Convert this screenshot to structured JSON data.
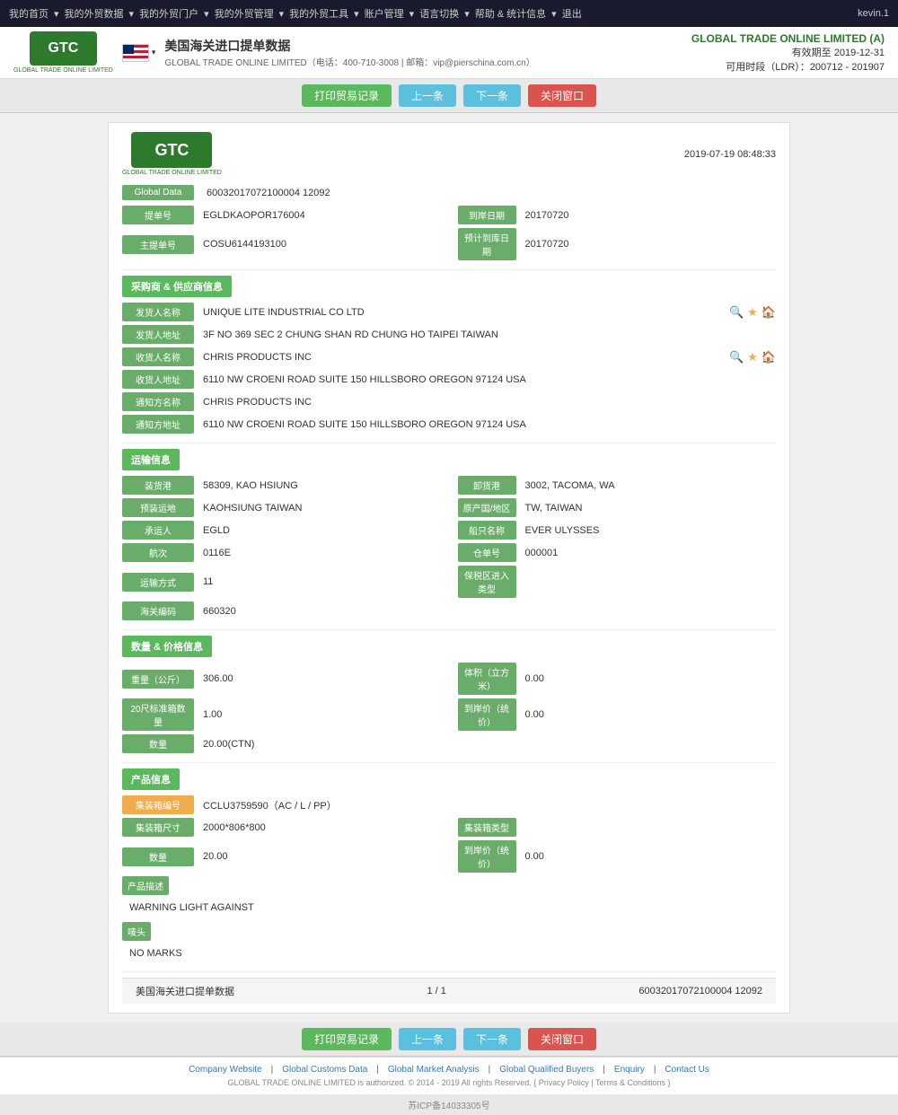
{
  "topnav": {
    "items": [
      "我的首页",
      "我的外贸数据",
      "我的外贸门户",
      "我的外贸管理",
      "我的外贸工具",
      "账户管理",
      "语言切换",
      "帮助 & 统计信息",
      "退出"
    ],
    "user": "kevin.1"
  },
  "header": {
    "logo": "GTC",
    "logo_sub": "GLOBAL TRADE ONLINE LIMITED",
    "flag_alt": "US Flag",
    "title": "美国海关进口提单数据",
    "subtitle_company": "GLOBAL TRADE ONLINE LIMITED",
    "subtitle_phone": "电话：400-710-3008",
    "subtitle_email": "邮箱：vip@pierschina.com.cn",
    "brand": "GLOBAL TRADE ONLINE LIMITED (A)",
    "validity_label": "有效期至",
    "validity_date": "2019-12-31",
    "ldr_label": "可用时段（LDR）：",
    "ldr_value": "200712 - 201907"
  },
  "toolbar": {
    "print_btn": "打印贸易记录",
    "prev_btn": "上一条",
    "next_btn": "下一条",
    "close_btn": "关闭窗口"
  },
  "doc": {
    "datetime": "2019-07-19 08:48:33",
    "global_data_label": "Global Data",
    "global_data_value": "60032017072100004 12092",
    "bill_label": "提单号",
    "bill_value": "EGLDKAOPOR176004",
    "arrival_date_label": "到岸日期",
    "arrival_date_value": "20170720",
    "master_bill_label": "主提单号",
    "master_bill_value": "COSU6144193100",
    "est_arrival_label": "预计到库日期",
    "est_arrival_value": "20170720"
  },
  "shipper": {
    "section_label": "采购商 & 供应商信息",
    "shipper_name_label": "发货人名称",
    "shipper_name_value": "UNIQUE LITE INDUSTRIAL CO LTD",
    "shipper_addr_label": "发货人地址",
    "shipper_addr_value": "3F NO 369 SEC 2 CHUNG SHAN RD CHUNG HO TAIPEI TAIWAN",
    "consignee_name_label": "收货人名称",
    "consignee_name_value": "CHRIS PRODUCTS INC",
    "consignee_addr_label": "收货人地址",
    "consignee_addr_value": "6110 NW CROENI ROAD SUITE 150 HILLSBORO OREGON 97124 USA",
    "notify_name_label": "通知方名称",
    "notify_name_value": "CHRIS PRODUCTS INC",
    "notify_addr_label": "通知方地址",
    "notify_addr_value": "6110 NW CROENI ROAD SUITE 150 HILLSBORO OREGON 97124 USA"
  },
  "shipping": {
    "section_label": "运输信息",
    "origin_port_label": "装货港",
    "origin_port_value": "58309, KAO HSIUNG",
    "dest_port_label": "卸货港",
    "dest_port_value": "3002, TACOMA, WA",
    "loading_place_label": "预装运地",
    "loading_place_value": "KAOHSIUNG TAIWAN",
    "origin_country_label": "原产国/地区",
    "origin_country_value": "TW, TAIWAN",
    "carrier_label": "承运人",
    "carrier_value": "EGLD",
    "vessel_label": "船只名称",
    "vessel_value": "EVER ULYSSES",
    "voyage_label": "航次",
    "voyage_value": "0116E",
    "warehouse_label": "仓单号",
    "warehouse_value": "000001",
    "transport_label": "运输方式",
    "transport_value": "11",
    "bonded_label": "保税区进入类型",
    "bonded_value": "",
    "customs_label": "海关编码",
    "customs_value": "660320"
  },
  "quantity": {
    "section_label": "数量 & 价格信息",
    "weight_label": "重量（公斤）",
    "weight_value": "306.00",
    "volume_label": "体积（立方米）",
    "volume_value": "0.00",
    "std20_label": "20尺标准箱数量",
    "std20_value": "1.00",
    "arrival_price_label": "到岸价（统价）",
    "arrival_price_value": "0.00",
    "qty_label": "数量",
    "qty_value": "20.00(CTN)"
  },
  "product": {
    "section_label": "产品信息",
    "container_no_label": "集装箱编号",
    "container_no_value": "CCLU3759590（AC / L / PP）",
    "container_size_label": "集装箱尺寸",
    "container_size_value": "2000*806*800",
    "container_type_label": "集装箱类型",
    "container_type_value": "",
    "qty_label": "数量",
    "qty_value": "20.00",
    "arrival_price_label": "到岸价（统价）",
    "arrival_price_value": "0.00",
    "desc_label": "产品描述",
    "desc_value": "WARNING LIGHT AGAINST",
    "marks_label": "唛头",
    "marks_value": "NO MARKS"
  },
  "pagination": {
    "source": "美国海关进口提单数据",
    "page": "1 / 1",
    "record_id": "60032017072100004 12092"
  },
  "footer": {
    "links": [
      "Company Website",
      "Global Customs Data",
      "Global Market Analysis",
      "Global Qualified Buyers",
      "Enquiry",
      "Contact Us"
    ],
    "copyright": "GLOBAL TRADE ONLINE LIMITED is authorized. © 2014 - 2019 All rights Reserved.",
    "privacy": "Privacy Policy",
    "terms": "Terms & Conditions",
    "icp": "苏ICP备14033305号"
  }
}
